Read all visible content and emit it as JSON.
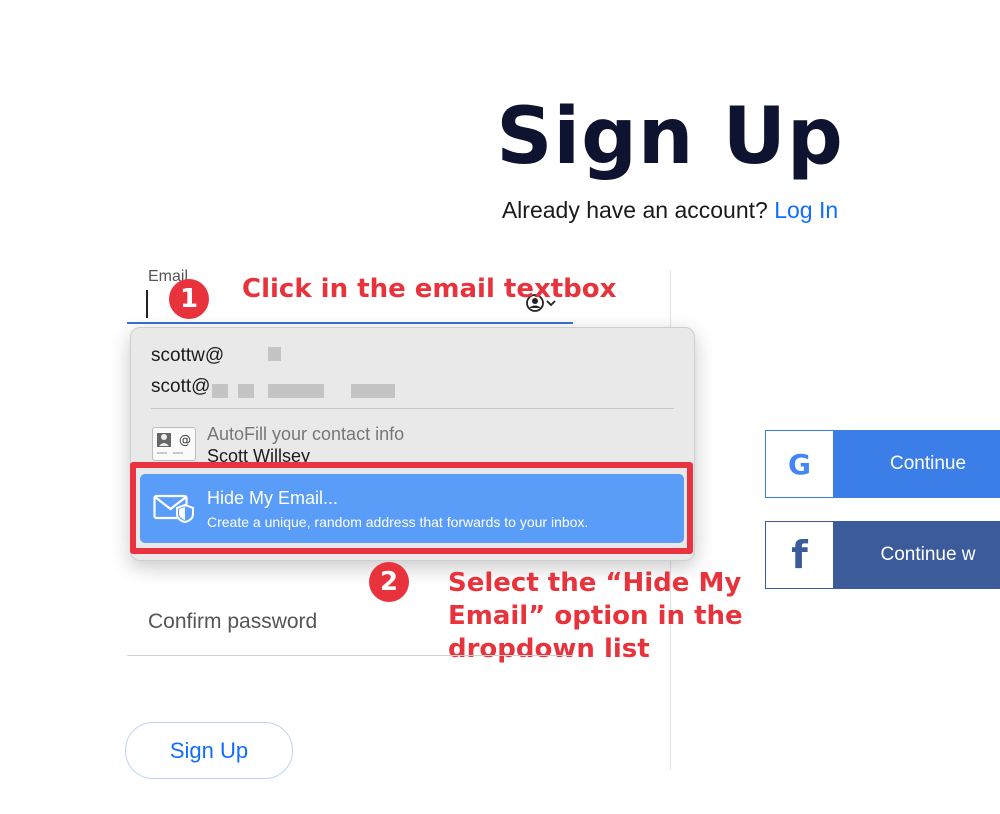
{
  "header": {
    "title": "Sign Up",
    "subtitle": "Already have an account?",
    "login_link": "Log In"
  },
  "form": {
    "email_label": "Email",
    "confirm_password_placeholder": "Confirm password",
    "signup_button": "Sign Up"
  },
  "dropdown": {
    "suggestions": [
      "scottw@",
      "scott@"
    ],
    "autofill_title": "AutoFill your contact info",
    "autofill_name": "Scott Willsey",
    "hide_my_email": {
      "title": "Hide My Email...",
      "subtitle": "Create a unique, random address that forwards to your inbox."
    }
  },
  "annotations": {
    "step1_number": "1",
    "step1_text": "Click in the email textbox",
    "step2_number": "2",
    "step2_text": "Select the “Hide My Email” option in the dropdown list"
  },
  "social": {
    "google_label": "Continue",
    "facebook_label": "Continue w",
    "google_icon": "google-icon",
    "facebook_icon": "facebook-icon"
  },
  "colors": {
    "accent": "#116dff",
    "annotation_red": "#e8323c",
    "hide_item_blue": "#5a9df8",
    "google_blue": "#3b7ee8",
    "facebook_blue": "#3b5b9a"
  }
}
